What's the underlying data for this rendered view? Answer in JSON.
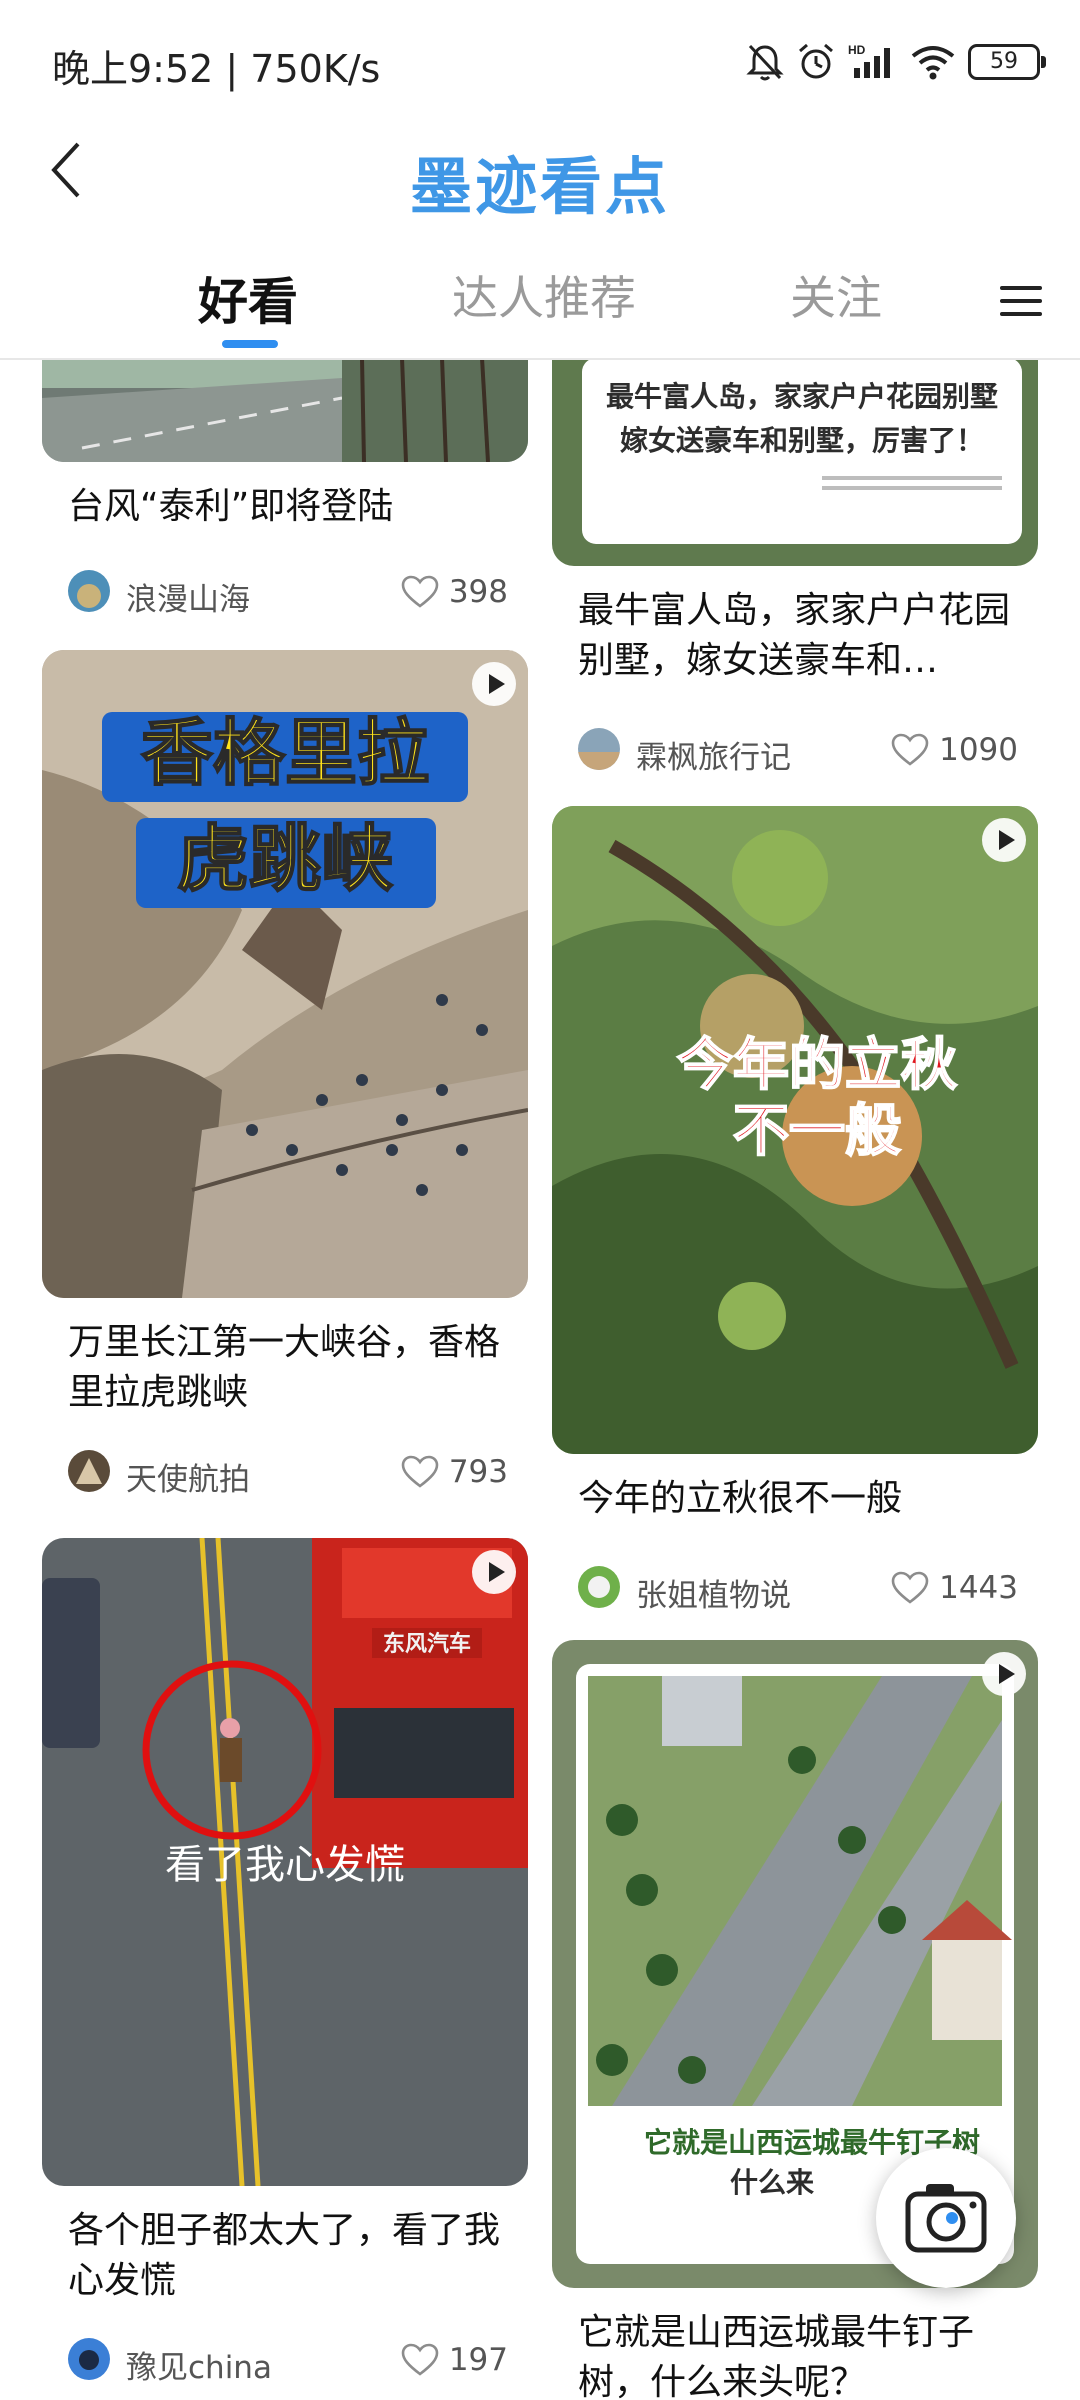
{
  "status_bar": {
    "time": "晚上9:52 | 750K/s",
    "battery": "59",
    "icons": [
      "mute-icon",
      "alarm-icon",
      "signal-icon",
      "wifi-icon",
      "battery-icon"
    ]
  },
  "header": {
    "title": "墨迹看点",
    "back_icon": "chevron-left-icon"
  },
  "tabs": [
    {
      "label": "好看",
      "active": true
    },
    {
      "label": "达人推荐",
      "active": false
    },
    {
      "label": "关注",
      "active": false
    }
  ],
  "menu_icon": "hamburger-icon",
  "colors": {
    "accent": "#2f8ef0",
    "brand": "#3f97e6",
    "heart": "#8c8c8c"
  },
  "feed": {
    "left": [
      {
        "title": "台风“泰利”即将登陆",
        "author": "浪漫山海",
        "likes": "398"
      },
      {
        "overlay": "香格里拉\n虎跳峡",
        "overlay_l1": "香格里拉",
        "overlay_l2": "虎跳峡",
        "title": "万里长江第一大峡谷，香格里拉虎跳峡",
        "author": "天使航拍",
        "likes": "793"
      },
      {
        "overlay": "看了我心发慌",
        "truck_text": "东风汽车",
        "title": "各个胆子都太大了，看了我心发慌",
        "author": "豫见china",
        "likes": "197"
      }
    ],
    "right": [
      {
        "image_text_1": "最牛富人岛，家家户户花园别墅",
        "image_text_2": "嫁女送豪车和别墅，厉害了！",
        "title": "最牛富人岛，家家户户花园别墅，嫁女送豪车和…",
        "author": "霖枫旅行记",
        "likes": "1090"
      },
      {
        "overlay_l1": "今年的立秋",
        "overlay_l2": "不一般",
        "title": "今年的立秋很不一般",
        "author": "张姐植物说",
        "likes": "1443"
      },
      {
        "image_text": "它就是山西运城最牛钉子树",
        "image_text_2": "什么来",
        "title": "它就是山西运城最牛钉子树，什么来头呢？"
      }
    ]
  },
  "fab_icon": "camera-icon"
}
